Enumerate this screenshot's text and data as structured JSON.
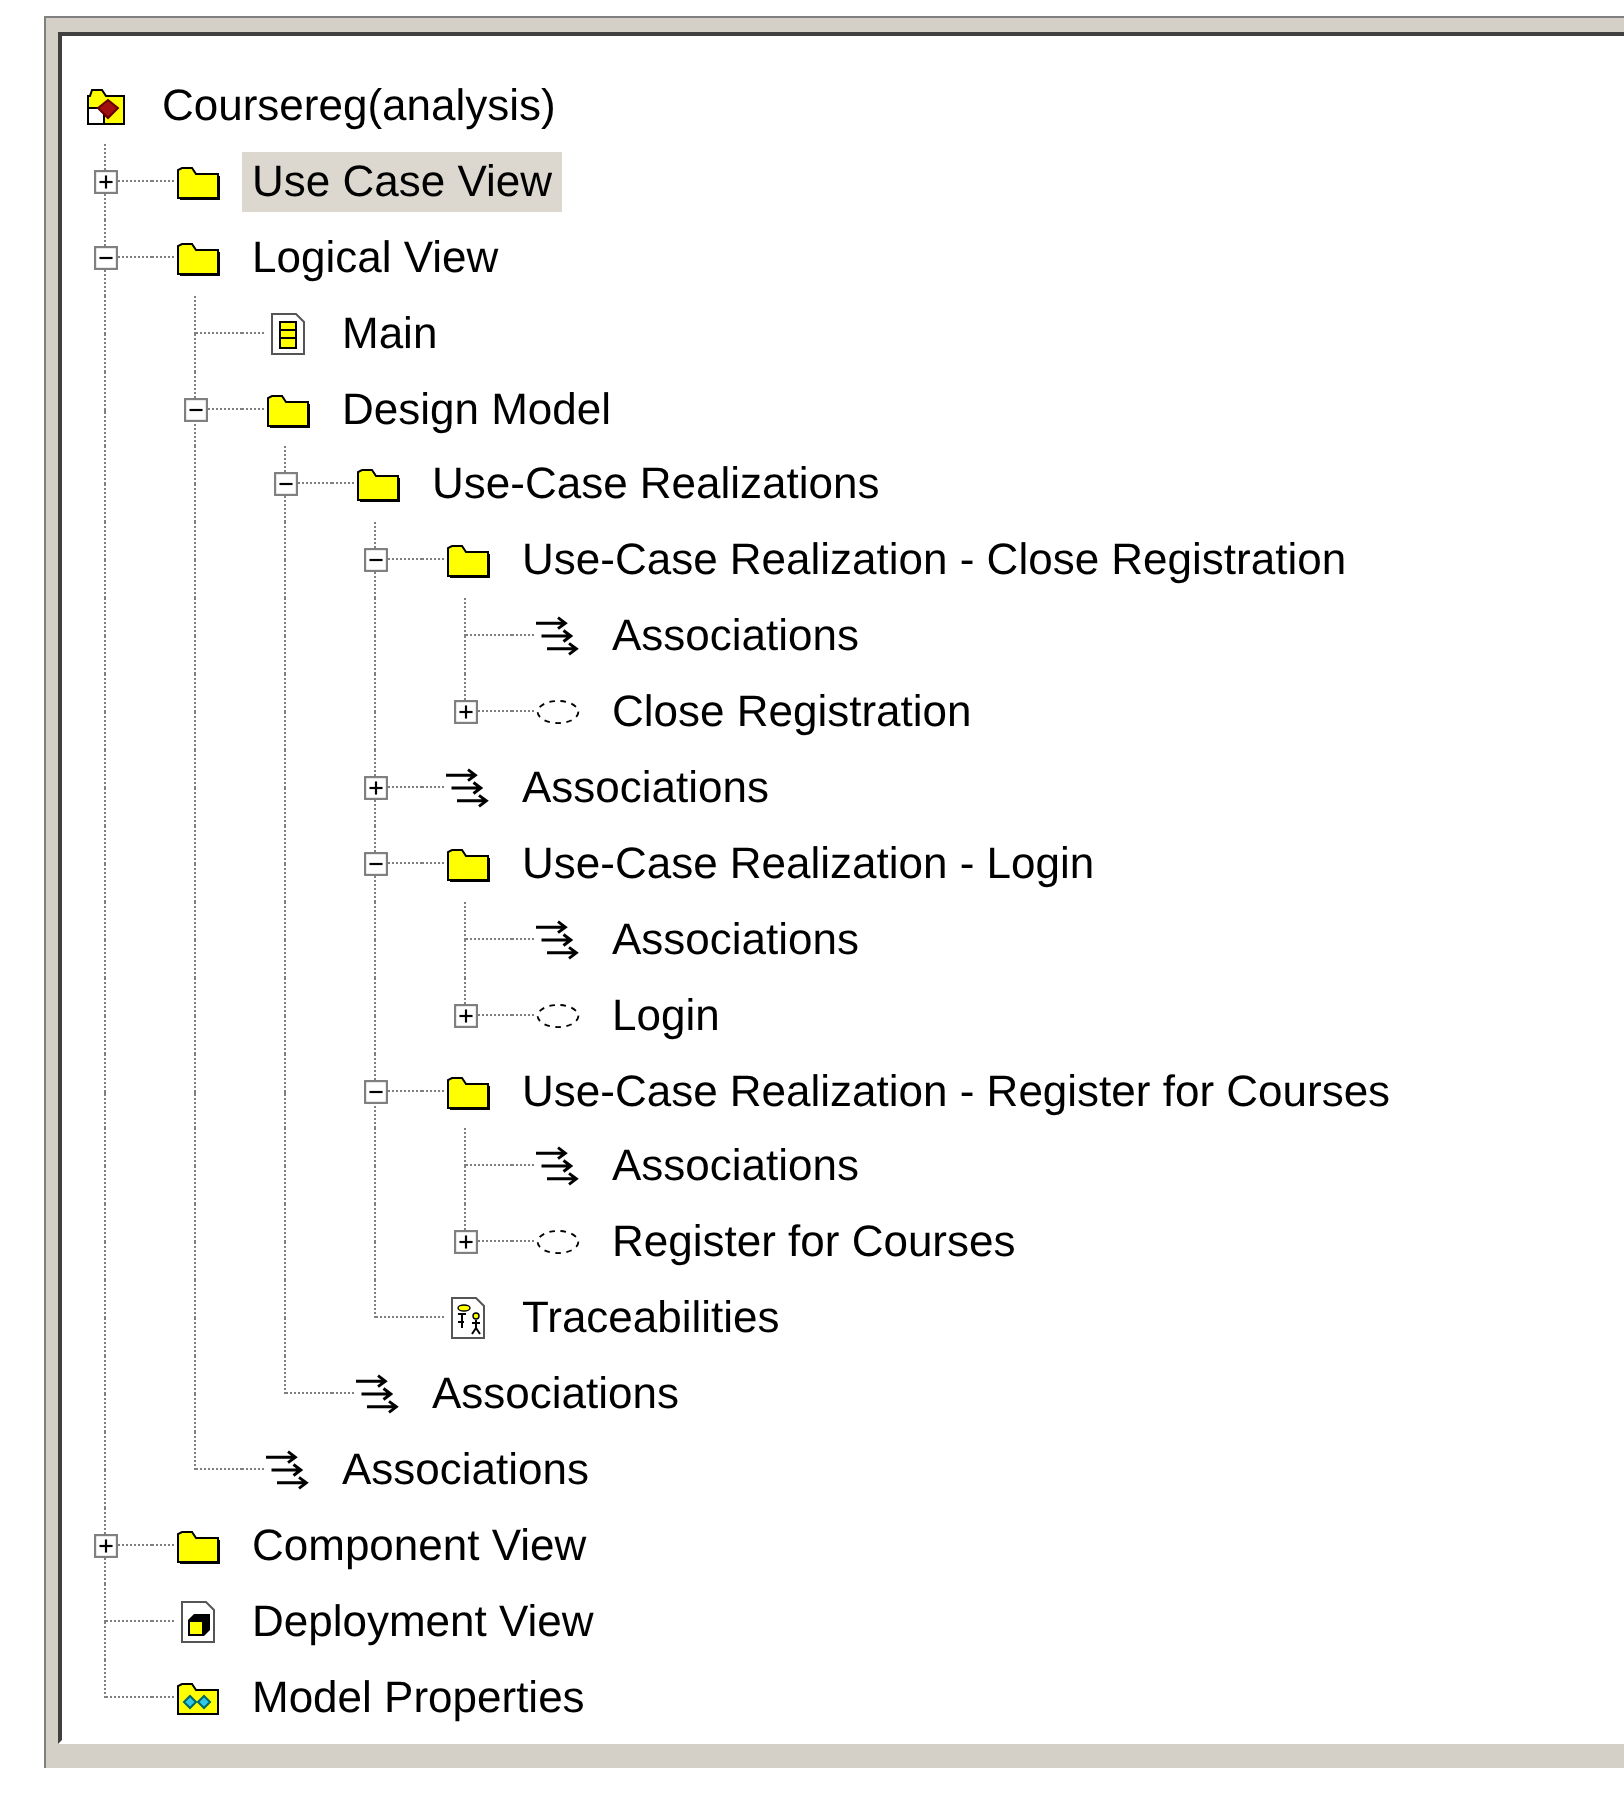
{
  "tree": {
    "label": "Coursereg(analysis)",
    "kind": "model",
    "selected": false,
    "children": [
      {
        "label": "Use Case View",
        "kind": "folder",
        "selected": true,
        "expanded": false
      },
      {
        "label": "Logical View",
        "kind": "folder",
        "selected": false,
        "expanded": true,
        "children": [
          {
            "label": "Main",
            "kind": "diagram",
            "selected": false
          },
          {
            "label": "Design Model",
            "kind": "folder",
            "selected": false,
            "expanded": true,
            "children": [
              {
                "label": "Use-Case Realizations",
                "kind": "folder",
                "selected": false,
                "expanded": true,
                "children": [
                  {
                    "label": "Use-Case Realization - Close Registration",
                    "kind": "folder",
                    "selected": false,
                    "expanded": true,
                    "children": [
                      {
                        "label": "Associations",
                        "kind": "associations",
                        "selected": false
                      },
                      {
                        "label": "Close Registration",
                        "kind": "usecase",
                        "selected": false,
                        "expanded": false
                      }
                    ]
                  },
                  {
                    "label": "Associations",
                    "kind": "associations",
                    "selected": false,
                    "expanded": false
                  },
                  {
                    "label": "Use-Case Realization - Login",
                    "kind": "folder",
                    "selected": false,
                    "expanded": true,
                    "children": [
                      {
                        "label": "Associations",
                        "kind": "associations",
                        "selected": false
                      },
                      {
                        "label": "Login",
                        "kind": "usecase",
                        "selected": false,
                        "expanded": false
                      }
                    ]
                  },
                  {
                    "label": "Use-Case Realization - Register for Courses",
                    "kind": "folder",
                    "selected": false,
                    "expanded": true,
                    "children": [
                      {
                        "label": "Associations",
                        "kind": "associations",
                        "selected": false
                      },
                      {
                        "label": "Register for Courses",
                        "kind": "usecase",
                        "selected": false,
                        "expanded": false
                      }
                    ]
                  },
                  {
                    "label": "Traceabilities",
                    "kind": "traceability",
                    "selected": false
                  }
                ]
              },
              {
                "label": "Associations",
                "kind": "associations",
                "selected": false
              }
            ]
          },
          {
            "label": "Associations",
            "kind": "associations",
            "selected": false
          }
        ]
      },
      {
        "label": "Component View",
        "kind": "folder",
        "selected": false,
        "expanded": false
      },
      {
        "label": "Deployment View",
        "kind": "deployment",
        "selected": false
      },
      {
        "label": "Model Properties",
        "kind": "properties",
        "selected": false
      }
    ]
  }
}
